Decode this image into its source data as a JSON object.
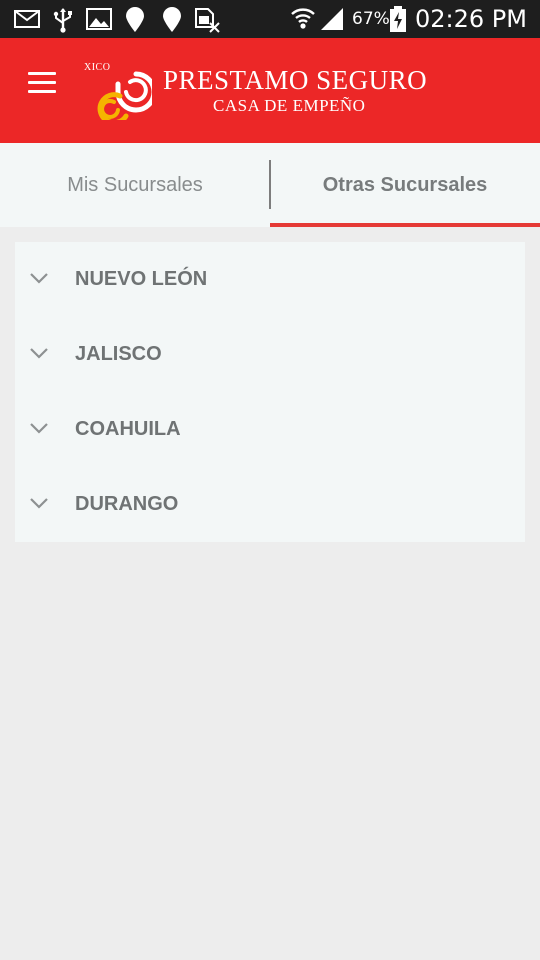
{
  "status_bar": {
    "battery_percent": "67%",
    "time": "02:26 PM",
    "icons": [
      "mail-icon",
      "usb-icon",
      "image-icon",
      "location-icon",
      "location-icon",
      "no-sim-icon",
      "wifi-icon",
      "signal-icon",
      "battery-charging-icon"
    ]
  },
  "app_bar": {
    "menu_icon": "hamburger-menu-icon",
    "logo": {
      "prefix": "XICO",
      "title": "PRESTAMO SEGURO",
      "subtitle": "CASA DE EMPEÑO"
    }
  },
  "tabs": [
    {
      "label": "Mis Sucursales",
      "active": false
    },
    {
      "label": "Otras Sucursales",
      "active": true
    }
  ],
  "states": [
    {
      "label": "NUEVO LEÓN",
      "icon": "chevron-down-icon"
    },
    {
      "label": "JALISCO",
      "icon": "chevron-down-icon"
    },
    {
      "label": "COAHUILA",
      "icon": "chevron-down-icon"
    },
    {
      "label": "DURANGO",
      "icon": "chevron-down-icon"
    }
  ],
  "colors": {
    "app_bar": "#ec2727",
    "status_bar": "#1e1e1e",
    "tab_indicator": "#e53935",
    "logo_yellow": "#f5b400",
    "background": "#ededed",
    "card": "#f3f7f7"
  }
}
